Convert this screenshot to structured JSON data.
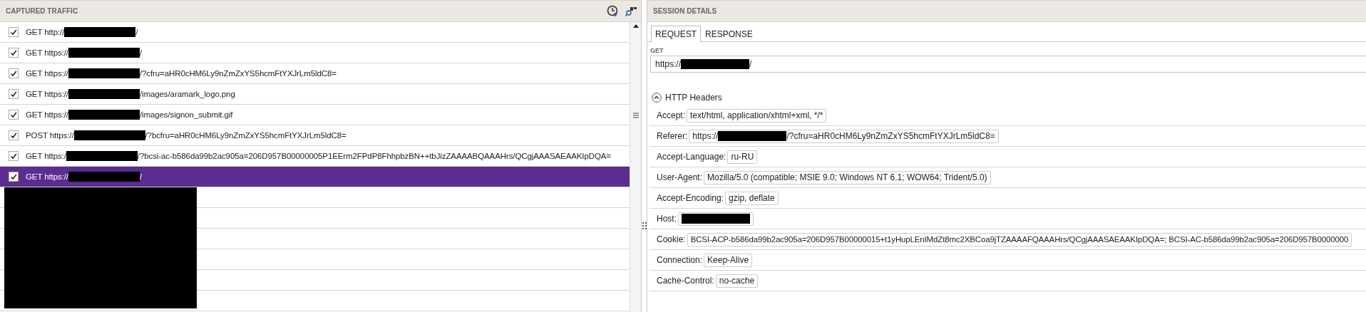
{
  "traffic": {
    "title": "CAPTURED TRAFFIC",
    "rows": [
      {
        "checked": true,
        "selected": false,
        "before": "GET http://",
        "redacted": true,
        "after": "/"
      },
      {
        "checked": true,
        "selected": false,
        "before": "GET https://",
        "redacted": true,
        "after": "/"
      },
      {
        "checked": true,
        "selected": false,
        "before": "GET https://",
        "redacted": true,
        "after": "/?cfru=aHR0cHM6Ly9nZmZxYS5hcmFtYXJrLm5ldC8="
      },
      {
        "checked": true,
        "selected": false,
        "before": "GET https://",
        "redacted": true,
        "after": "/images/aramark_logo.png"
      },
      {
        "checked": true,
        "selected": false,
        "before": "GET https://",
        "redacted": true,
        "after": "/images/signon_submit.gif"
      },
      {
        "checked": true,
        "selected": false,
        "before": "POST https://",
        "redacted": true,
        "after": "/?bcfru=aHR0cHM6Ly9nZmZxYS5hcmFtYXJrLm5ldC8="
      },
      {
        "checked": true,
        "selected": false,
        "before": "GET https:/",
        "redacted": true,
        "after": "/?bcsi-ac-b586da99b2ac905a=206D957B00000005P1EErm2FPdP8FhhpbzBN++tbJizZAAAABQAAAHrs/QCgjAAASAEAAKIpDQA="
      },
      {
        "checked": true,
        "selected": true,
        "before": "GET https://",
        "redacted": true,
        "after": "/"
      }
    ]
  },
  "session": {
    "title": "SESSION DETAILS",
    "tabs": [
      {
        "label": "REQUEST",
        "selected": true
      },
      {
        "label": "RESPONSE",
        "selected": false
      }
    ],
    "method_label": "GET",
    "url": {
      "before": "https://",
      "redacted": true,
      "after": "/"
    },
    "headers_section": {
      "label": "HTTP Headers",
      "expanded": true,
      "items": [
        {
          "name": "Accept:",
          "value": "text/html, application/xhtml+xml, */*"
        },
        {
          "name": "Referer:",
          "before": "https://",
          "redacted": true,
          "after": "/?cfru=aHR0cHM6Ly9nZmZxYS5hcmFtYXJrLm5ldC8="
        },
        {
          "name": "Accept-Language:",
          "value": "ru-RU"
        },
        {
          "name": "User-Agent:",
          "value": "Mozilla/5.0 (compatible; MSIE 9.0; Windows NT 6.1; WOW64; Trident/5.0)"
        },
        {
          "name": "Accept-Encoding:",
          "value": "gzip, deflate"
        },
        {
          "name": "Host:",
          "redacted": true
        },
        {
          "name": "Cookie:",
          "value": "BCSI-ACP-b586da99b2ac905a=206D957B00000015+t1yHupLEnIMdZt8mc2XBCoa9jTZAAAAFQAAAHrs/QCgjAAASAEAAKIpDQA=; BCSI-AC-b586da99b2ac905a=206D957B0000000"
        },
        {
          "name": "Connection:",
          "value": "Keep-Alive"
        },
        {
          "name": "Cache-Control:",
          "value": "no-cache"
        }
      ]
    }
  }
}
